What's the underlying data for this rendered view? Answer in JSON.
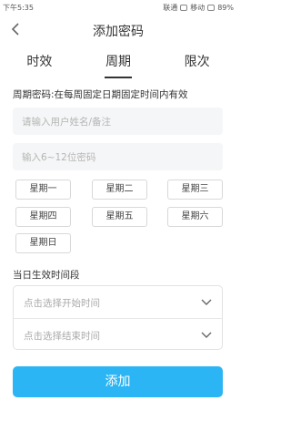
{
  "status_bar": {
    "time": "下午5:35",
    "network_label": "联通",
    "mobile_label": "移动",
    "battery": "89%"
  },
  "header": {
    "title": "添加密码"
  },
  "tabs": [
    {
      "label": "时效",
      "active": false
    },
    {
      "label": "周期",
      "active": true
    },
    {
      "label": "限次",
      "active": false
    }
  ],
  "description": "周期密码:在每周固定日期固定时间内有效",
  "form": {
    "name_placeholder": "请输入用户姓名/备注",
    "password_placeholder": "输入6~12位密码"
  },
  "weekdays": [
    "星期一",
    "星期二",
    "星期三",
    "星期四",
    "星期五",
    "星期六",
    "星期日"
  ],
  "time_section": {
    "label": "当日生效时间段",
    "start_placeholder": "点击选择开始时间",
    "end_placeholder": "点击选择结束时间"
  },
  "submit_label": "添加",
  "colors": {
    "accent": "#2bb5f4",
    "field_bg": "#f5f6f7"
  }
}
